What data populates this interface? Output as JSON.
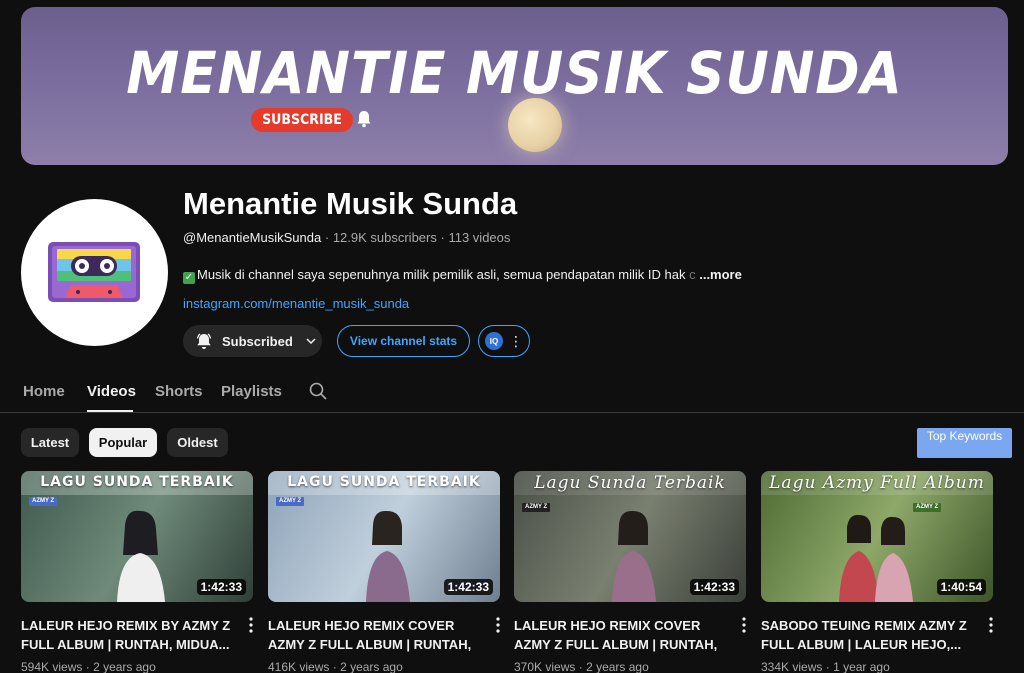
{
  "banner": {
    "title": "MENANTIE MUSIK SUNDA",
    "subscribe_label": "SUBSCRIBE"
  },
  "channel": {
    "name": "Menantie Musik Sunda",
    "handle": "@MenantieMusikSunda",
    "subscribers": "12.9K subscribers",
    "videos": "113 videos",
    "separator": "·",
    "description": "Musik di channel saya sepenuhnya milik pemilik asli, semua pendapatan milik ID hak",
    "description_fade": " c",
    "more_label": "...more",
    "link": "instagram.com/menantie_musik_sunda"
  },
  "actions": {
    "subscribed_label": "Subscribed",
    "stats_label": "View channel stats",
    "ext_label": "IQ"
  },
  "tabs": [
    {
      "label": "Home"
    },
    {
      "label": "Videos"
    },
    {
      "label": "Shorts"
    },
    {
      "label": "Playlists"
    }
  ],
  "filters": {
    "chips": [
      {
        "label": "Latest"
      },
      {
        "label": "Popular"
      },
      {
        "label": "Oldest"
      }
    ],
    "selected": "Popular",
    "top_keywords": "Top Keywords"
  },
  "videos": [
    {
      "thumb_text": "LAGU SUNDA TERBAIK",
      "tag": "AZMY Z",
      "duration": "1:42:33",
      "title": "LALEUR HEJO REMIX BY AZMY Z FULL ALBUM | RUNTAH, MIDUA...",
      "views": "594K views",
      "age": "2 years ago",
      "accent": "#4d6a5c"
    },
    {
      "thumb_text": "LAGU SUNDA TERBAIK",
      "tag": "AZMY Z",
      "duration": "1:42:33",
      "title": "LALEUR HEJO REMIX COVER AZMY Z FULL ALBUM | RUNTAH, MIDUA...",
      "views": "416K views",
      "age": "2 years ago",
      "accent": "#7a8fa6"
    },
    {
      "thumb_text": "Lagu Sunda Terbaik",
      "tag": "AZMY Z",
      "duration": "1:42:33",
      "title": "LALEUR HEJO REMIX COVER AZMY Z FULL ALBUM | RUNTAH, MIDUA...",
      "views": "370K views",
      "age": "2 years ago",
      "accent": "#5a6158"
    },
    {
      "thumb_text": "Lagu Azmy Full Album",
      "tag": "AZMY Z",
      "duration": "1:40:54",
      "title": "SABODO TEUING REMIX AZMY Z FULL ALBUM | LALEUR HEJO,...",
      "views": "334K views",
      "age": "1 year ago",
      "accent": "#5f7a3d"
    }
  ],
  "colors": {
    "background": "#0f0f0f",
    "link": "#3ea6ff",
    "subscribe_red": "#e53b2a"
  }
}
